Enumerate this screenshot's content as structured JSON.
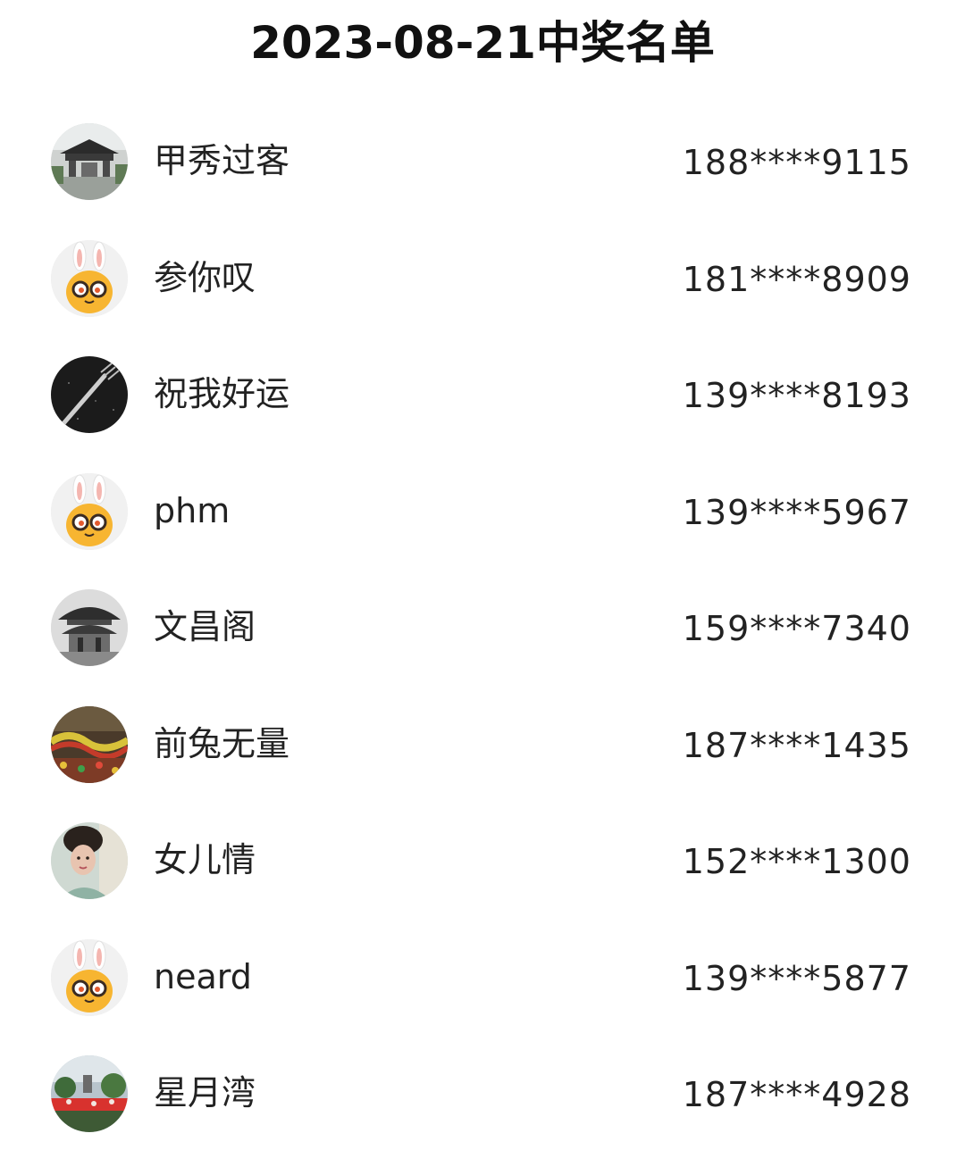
{
  "title": "2023-08-21中奖名单",
  "winners": [
    {
      "name": "甲秀过客",
      "phone": "188****9115",
      "avatar": "photo-gate-avatar"
    },
    {
      "name": "参你叹",
      "phone": "181****8909",
      "avatar": "rabbit-mascot-avatar"
    },
    {
      "name": "祝我好运",
      "phone": "139****8193",
      "avatar": "dark-fork-avatar"
    },
    {
      "name": "phm",
      "phone": "139****5967",
      "avatar": "rabbit-mascot-avatar"
    },
    {
      "name": "文昌阁",
      "phone": "159****7340",
      "avatar": "pavilion-photo-avatar"
    },
    {
      "name": "前兔无量",
      "phone": "187****1435",
      "avatar": "dragon-dance-avatar"
    },
    {
      "name": "女儿情",
      "phone": "152****1300",
      "avatar": "portrait-photo-avatar"
    },
    {
      "name": "neard",
      "phone": "139****5877",
      "avatar": "rabbit-mascot-avatar"
    },
    {
      "name": "星月湾",
      "phone": "187****4928",
      "avatar": "garden-photo-avatar"
    }
  ]
}
